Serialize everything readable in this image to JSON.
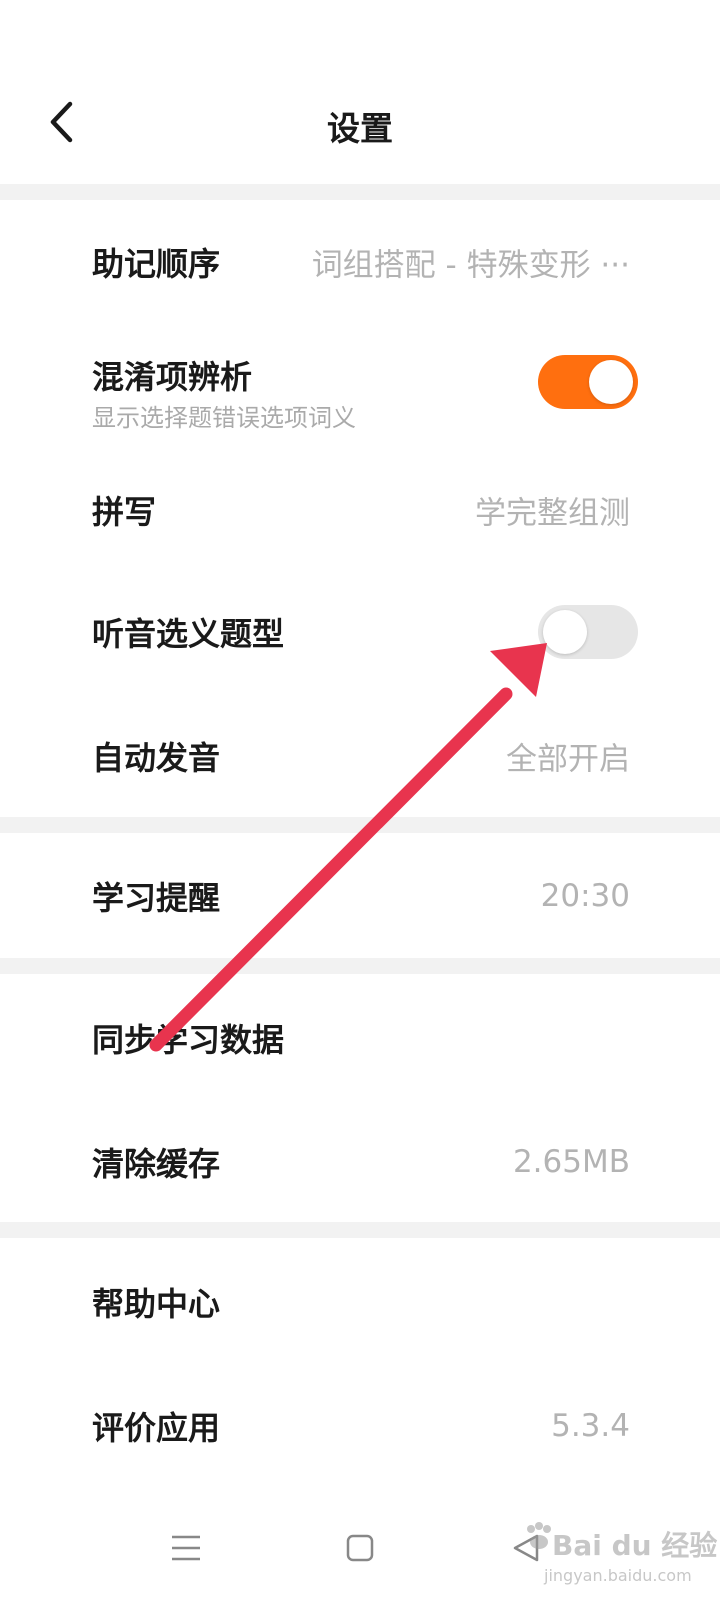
{
  "header": {
    "title": "设置",
    "back_icon": "chevron-left-icon"
  },
  "settings": {
    "mnemonic_order": {
      "label": "助记顺序",
      "value": "词组搭配 - 特殊变形 ···"
    },
    "confusion_analysis": {
      "label": "混淆项辨析",
      "sublabel": "显示选择题错误选项词义",
      "enabled": true
    },
    "spelling": {
      "label": "拼写",
      "value": "学完整组测"
    },
    "listening_type": {
      "label": "听音选义题型",
      "enabled": false
    },
    "auto_pronounce": {
      "label": "自动发音",
      "value": "全部开启"
    },
    "study_reminder": {
      "label": "学习提醒",
      "value": "20:30"
    },
    "sync_data": {
      "label": "同步学习数据"
    },
    "clear_cache": {
      "label": "清除缓存",
      "value": "2.65MB"
    },
    "help_center": {
      "label": "帮助中心"
    },
    "rate_app": {
      "label": "评价应用",
      "value": "5.3.4"
    }
  },
  "navbar": {
    "menu_icon": "menu-icon",
    "home_icon": "square-home-icon",
    "back_icon": "triangle-back-icon"
  },
  "watermark": {
    "brand": "Bai du 经验",
    "url": "jingyan.baidu.com"
  },
  "colors": {
    "accent": "#ff6f0f",
    "toggle_off": "#e6e6e6",
    "value_text": "#b3b3b3",
    "separator": "#f2f2f2",
    "annotation_arrow": "#e8344e"
  }
}
